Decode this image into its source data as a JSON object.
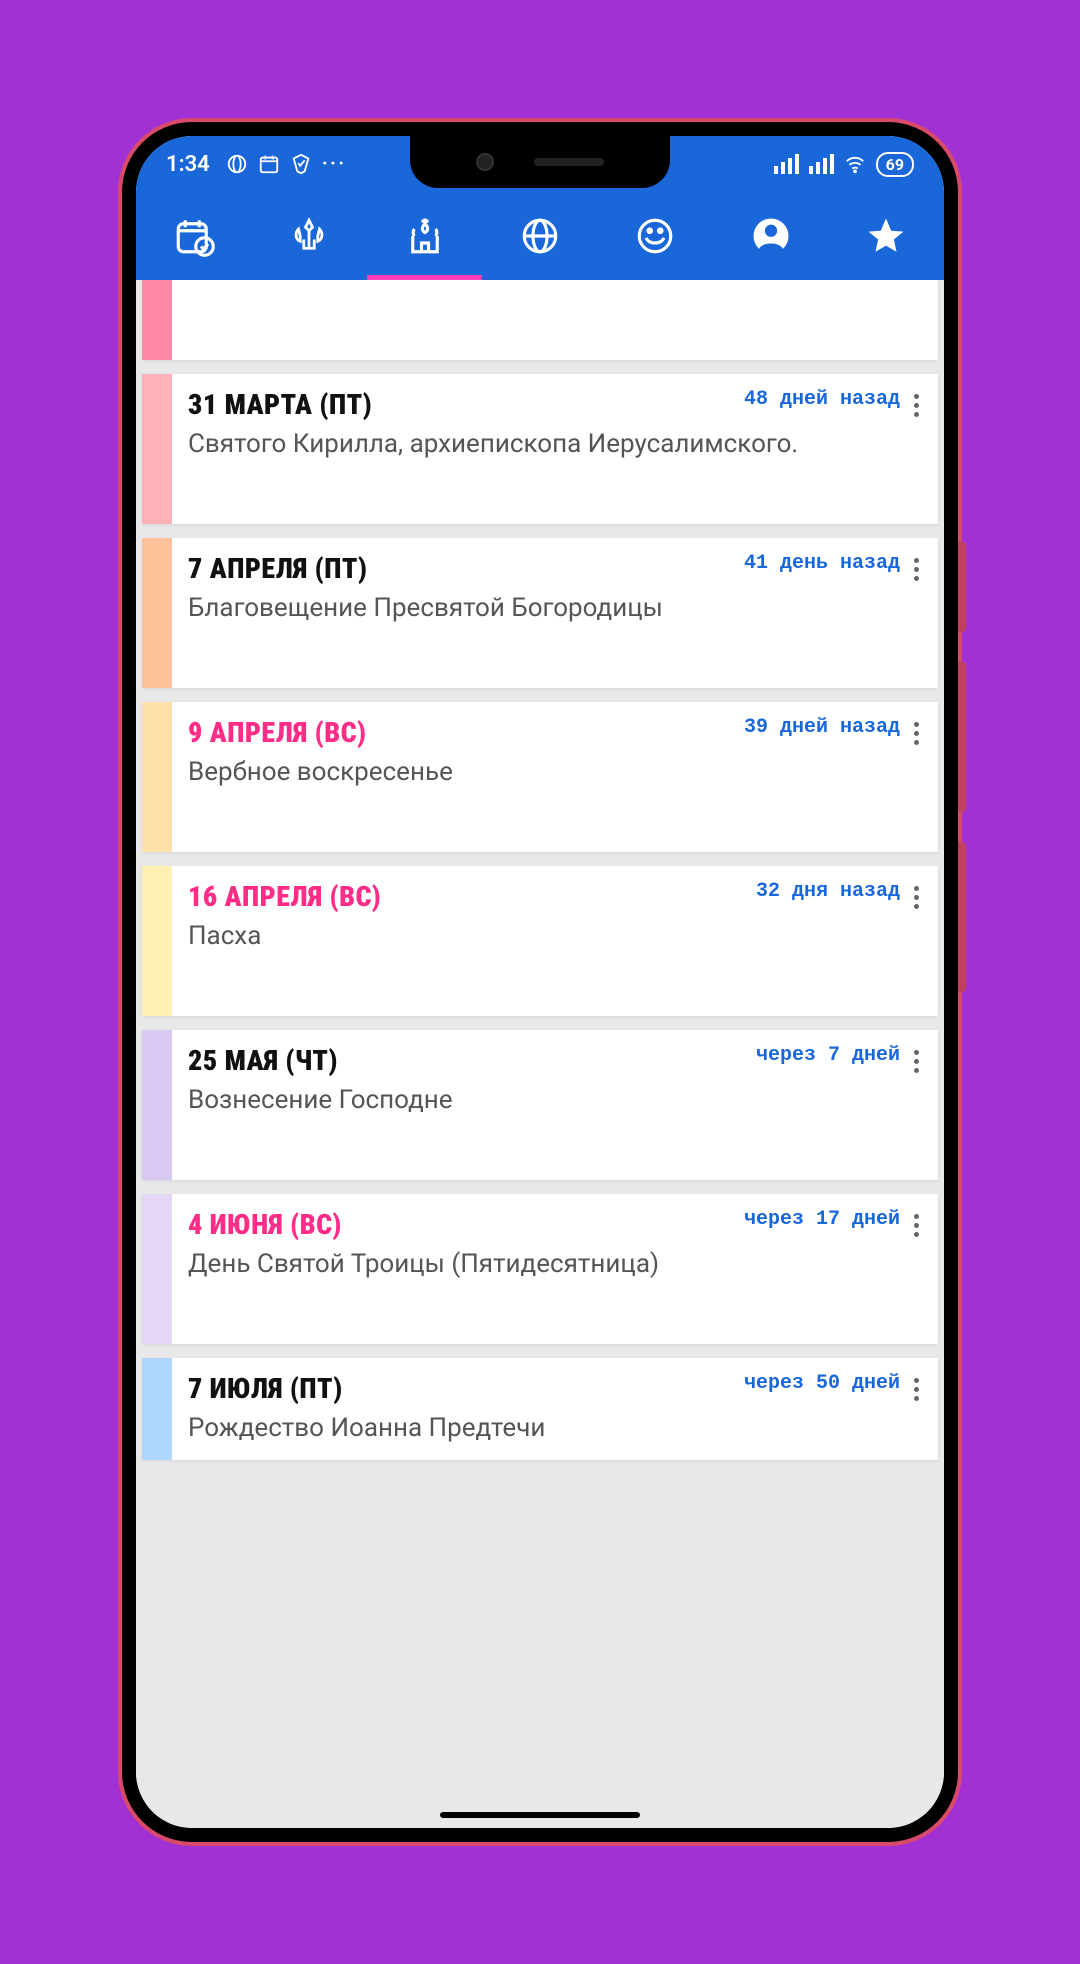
{
  "status": {
    "time": "1:34",
    "battery": "69"
  },
  "tabs": {
    "active_index": 2,
    "items": [
      "calendar",
      "emblem",
      "church",
      "globe",
      "smile",
      "person",
      "star"
    ]
  },
  "events": [
    {
      "date": "",
      "relative": "",
      "desc": "",
      "color": "#ff8aa7",
      "date_pink": false,
      "partial": "first"
    },
    {
      "date": "31 МАРТА (ПТ)",
      "relative": "48 дней назад",
      "desc": "Святого Кирилла, архиепископа Иерусалимского.",
      "color": "#ffb0b9",
      "date_pink": false
    },
    {
      "date": "7 АПРЕЛЯ (ПТ)",
      "relative": "41 день назад",
      "desc": "Благовещение Пресвятой Богородицы",
      "color": "#ffc19a",
      "date_pink": false
    },
    {
      "date": "9 АПРЕЛЯ (ВС)",
      "relative": "39 дней назад",
      "desc": "Вербное воскресенье",
      "color": "#ffe0a8",
      "date_pink": true
    },
    {
      "date": "16 АПРЕЛЯ (ВС)",
      "relative": "32 дня назад",
      "desc": "Пасха",
      "color": "#ffefb0",
      "date_pink": true
    },
    {
      "date": "25 МАЯ (ЧТ)",
      "relative": "через 7 дней",
      "desc": "Вознесение Господне",
      "color": "#d7c9f2",
      "date_pink": false
    },
    {
      "date": "4 ИЮНЯ (ВС)",
      "relative": "через 17 дней",
      "desc": "День Святой Троицы (Пятидесятница)",
      "color": "#e4d6f7",
      "date_pink": true
    },
    {
      "date": "7 ИЮЛЯ (ПТ)",
      "relative": "через 50 дней",
      "desc": "Рождество Иоанна Предтечи",
      "color": "#aed6ff",
      "date_pink": false,
      "partial": "last"
    }
  ]
}
